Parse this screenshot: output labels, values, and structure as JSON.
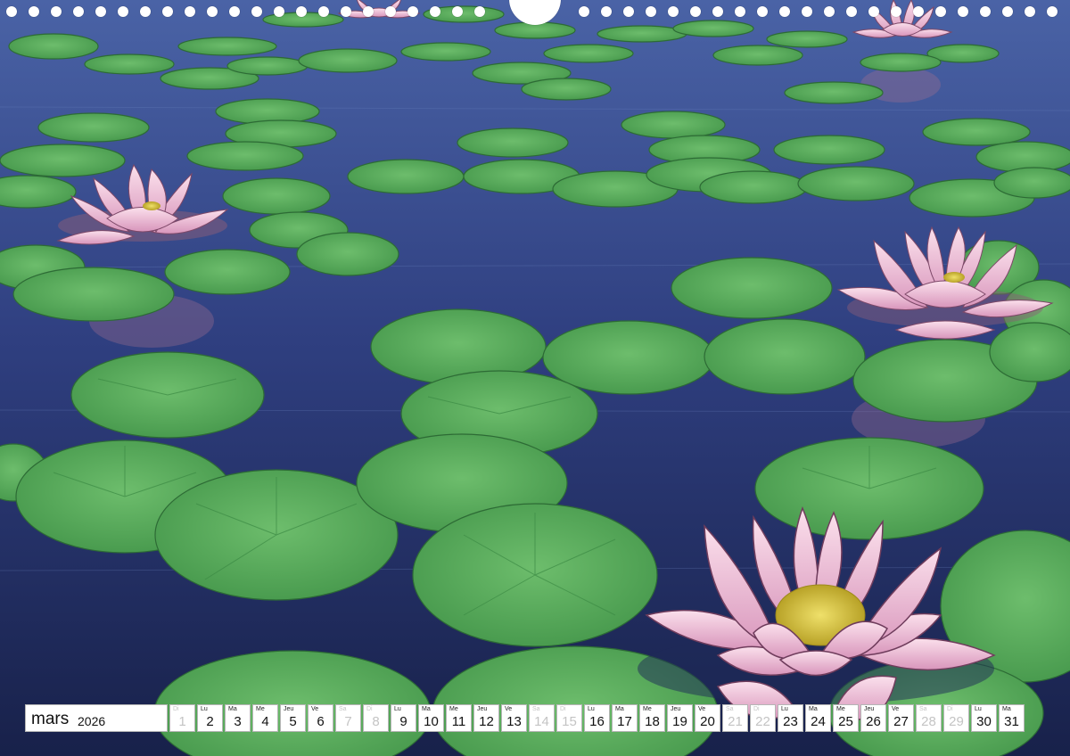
{
  "calendar": {
    "month": "mars",
    "year": "2026",
    "days": [
      {
        "wd": "Di",
        "d": "1",
        "weekend": true
      },
      {
        "wd": "Lu",
        "d": "2",
        "weekend": false
      },
      {
        "wd": "Ma",
        "d": "3",
        "weekend": false
      },
      {
        "wd": "Me",
        "d": "4",
        "weekend": false
      },
      {
        "wd": "Jeu",
        "d": "5",
        "weekend": false
      },
      {
        "wd": "Ve",
        "d": "6",
        "weekend": false
      },
      {
        "wd": "Sa",
        "d": "7",
        "weekend": true
      },
      {
        "wd": "Di",
        "d": "8",
        "weekend": true
      },
      {
        "wd": "Lu",
        "d": "9",
        "weekend": false
      },
      {
        "wd": "Ma",
        "d": "10",
        "weekend": false
      },
      {
        "wd": "Me",
        "d": "11",
        "weekend": false
      },
      {
        "wd": "Jeu",
        "d": "12",
        "weekend": false
      },
      {
        "wd": "Ve",
        "d": "13",
        "weekend": false
      },
      {
        "wd": "Sa",
        "d": "14",
        "weekend": true
      },
      {
        "wd": "Di",
        "d": "15",
        "weekend": true
      },
      {
        "wd": "Lu",
        "d": "16",
        "weekend": false
      },
      {
        "wd": "Ma",
        "d": "17",
        "weekend": false
      },
      {
        "wd": "Me",
        "d": "18",
        "weekend": false
      },
      {
        "wd": "Jeu",
        "d": "19",
        "weekend": false
      },
      {
        "wd": "Ve",
        "d": "20",
        "weekend": false
      },
      {
        "wd": "Sa",
        "d": "21",
        "weekend": true
      },
      {
        "wd": "Di",
        "d": "22",
        "weekend": true
      },
      {
        "wd": "Lu",
        "d": "23",
        "weekend": false
      },
      {
        "wd": "Ma",
        "d": "24",
        "weekend": false
      },
      {
        "wd": "Me",
        "d": "25",
        "weekend": false
      },
      {
        "wd": "Jeu",
        "d": "26",
        "weekend": false
      },
      {
        "wd": "Ve",
        "d": "27",
        "weekend": false
      },
      {
        "wd": "Sa",
        "d": "28",
        "weekend": true
      },
      {
        "wd": "Di",
        "d": "29",
        "weekend": true
      },
      {
        "wd": "Lu",
        "d": "30",
        "weekend": false
      },
      {
        "wd": "Ma",
        "d": "31",
        "weekend": false
      }
    ]
  },
  "colors": {
    "water_top": "#3b4f95",
    "water_bottom": "#1a2450",
    "leaf": "#5cae5f",
    "leaf_dark": "#3f8d47",
    "petal": "#f0bfd6",
    "petal_dark": "#c98aae",
    "stamen": "#d9c737"
  },
  "scene": {
    "icons": [
      "lily-pad-icon",
      "lotus-flower-icon",
      "spiral-binding-icon"
    ]
  }
}
